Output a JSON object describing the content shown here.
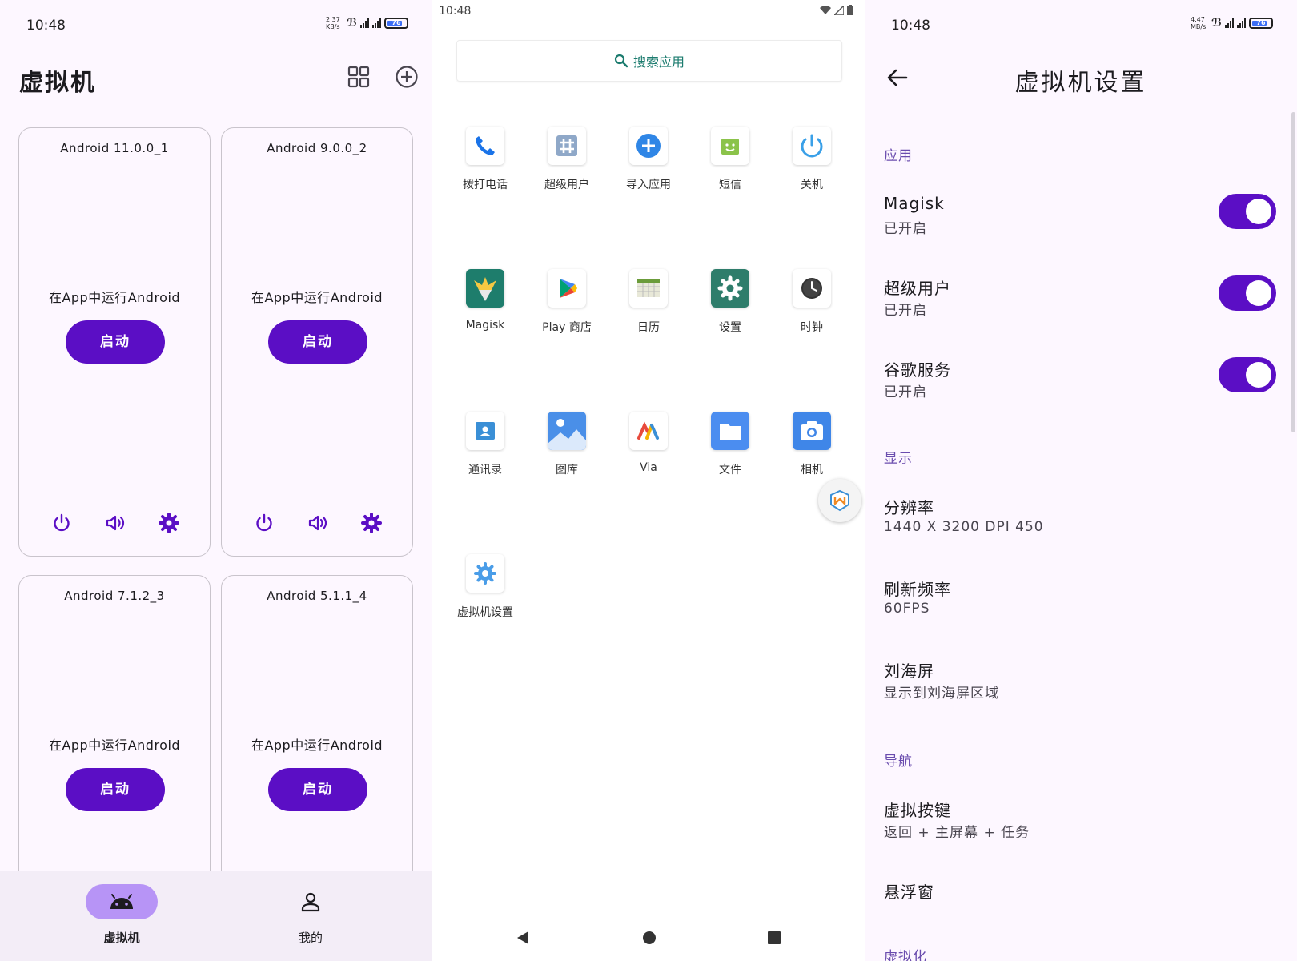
{
  "panel1": {
    "status": {
      "time": "10:48",
      "speed": "2.37 KB/s",
      "battery": "76"
    },
    "title": "虚拟机",
    "cards": [
      {
        "name": "Android 11.0.0_1",
        "subtitle": "在App中运行Android",
        "button": "启动"
      },
      {
        "name": "Android 9.0.0_2",
        "subtitle": "在App中运行Android",
        "button": "启动"
      },
      {
        "name": "Android 7.1.2_3",
        "subtitle": "在App中运行Android",
        "button": "启动"
      },
      {
        "name": "Android 5.1.1_4",
        "subtitle": "在App中运行Android",
        "button": "启动"
      }
    ],
    "nav": [
      {
        "label": "虚拟机",
        "icon": "android-icon",
        "active": true
      },
      {
        "label": "我的",
        "icon": "person-icon",
        "active": false
      }
    ],
    "accent": "#5b0ec5"
  },
  "panel2": {
    "status": {
      "time": "10:48"
    },
    "search_placeholder": "搜索应用",
    "apps": [
      {
        "label": "拨打电话",
        "icon": "phone-icon"
      },
      {
        "label": "超级用户",
        "icon": "superuser-icon"
      },
      {
        "label": "导入应用",
        "icon": "import-app-icon"
      },
      {
        "label": "短信",
        "icon": "sms-icon"
      },
      {
        "label": "关机",
        "icon": "power-icon"
      },
      {
        "label": "Magisk",
        "icon": "magisk-icon"
      },
      {
        "label": "Play 商店",
        "icon": "play-store-icon"
      },
      {
        "label": "日历",
        "icon": "calendar-icon"
      },
      {
        "label": "设置",
        "icon": "settings-icon"
      },
      {
        "label": "时钟",
        "icon": "clock-icon"
      },
      {
        "label": "通讯录",
        "icon": "contacts-icon"
      },
      {
        "label": "图库",
        "icon": "gallery-icon"
      },
      {
        "label": "Via",
        "icon": "via-browser-icon"
      },
      {
        "label": "文件",
        "icon": "files-icon"
      },
      {
        "label": "相机",
        "icon": "camera-icon"
      },
      {
        "label": "虚拟机设置",
        "icon": "vm-settings-icon"
      }
    ]
  },
  "panel3": {
    "status": {
      "time": "10:48",
      "speed": "4.47 MB/s",
      "battery": "76"
    },
    "title": "虚拟机设置",
    "sections": {
      "apps": "应用",
      "display": "显示",
      "navigation": "导航",
      "virtualization": "虚拟化"
    },
    "items": {
      "magisk": {
        "title": "Magisk",
        "subtitle": "已开启",
        "enabled": true
      },
      "superuser": {
        "title": "超级用户",
        "subtitle": "已开启",
        "enabled": true
      },
      "gms": {
        "title": "谷歌服务",
        "subtitle": "已开启",
        "enabled": true
      },
      "resolution": {
        "title": "分辨率",
        "subtitle": "1440 X 3200 DPI 450"
      },
      "refresh": {
        "title": "刷新频率",
        "subtitle": "60FPS"
      },
      "notch": {
        "title": "刘海屏",
        "subtitle": "显示到刘海屏区域"
      },
      "vkeys": {
        "title": "虚拟按键",
        "subtitle": "返回 + 主屏幕 + 任务"
      },
      "floating": {
        "title": "悬浮窗"
      }
    }
  }
}
